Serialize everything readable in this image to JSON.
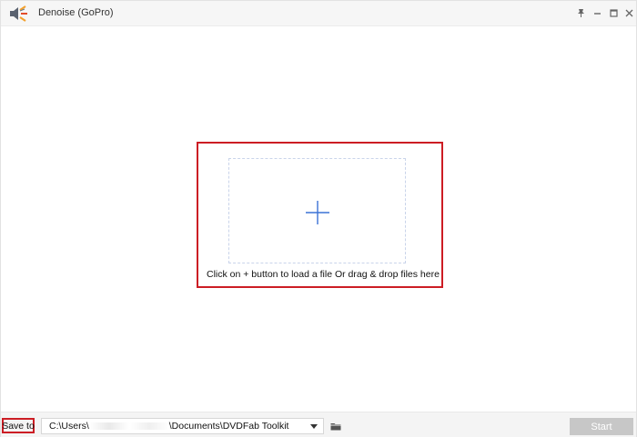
{
  "window": {
    "title": "Denoise (GoPro)",
    "logo_icon": "dvdfab-speaker-logo-icon",
    "controls": [
      {
        "name": "pin-icon"
      },
      {
        "name": "minimize-icon"
      },
      {
        "name": "maximize-icon"
      },
      {
        "name": "close-icon"
      }
    ]
  },
  "dropzone": {
    "add_icon": "plus-icon",
    "hint": "Click on + button to load a file Or drag & drop files here",
    "highlight_color": "#cc1d24",
    "plus_color": "#3b72d6"
  },
  "footer": {
    "save_label": "Save to",
    "path": "C:\\Users\\[redacted]\\Documents\\DVDFab Toolkit",
    "path_prefix": "C:\\Users\\",
    "path_suffix": "\\Documents\\DVDFab Toolkit",
    "folder_icon": "folder-icon",
    "start_label": "Start"
  },
  "colors": {
    "accent_blue": "#3b72d6",
    "highlight_red": "#cc1d24",
    "disabled_button": "#c7c7c7"
  }
}
